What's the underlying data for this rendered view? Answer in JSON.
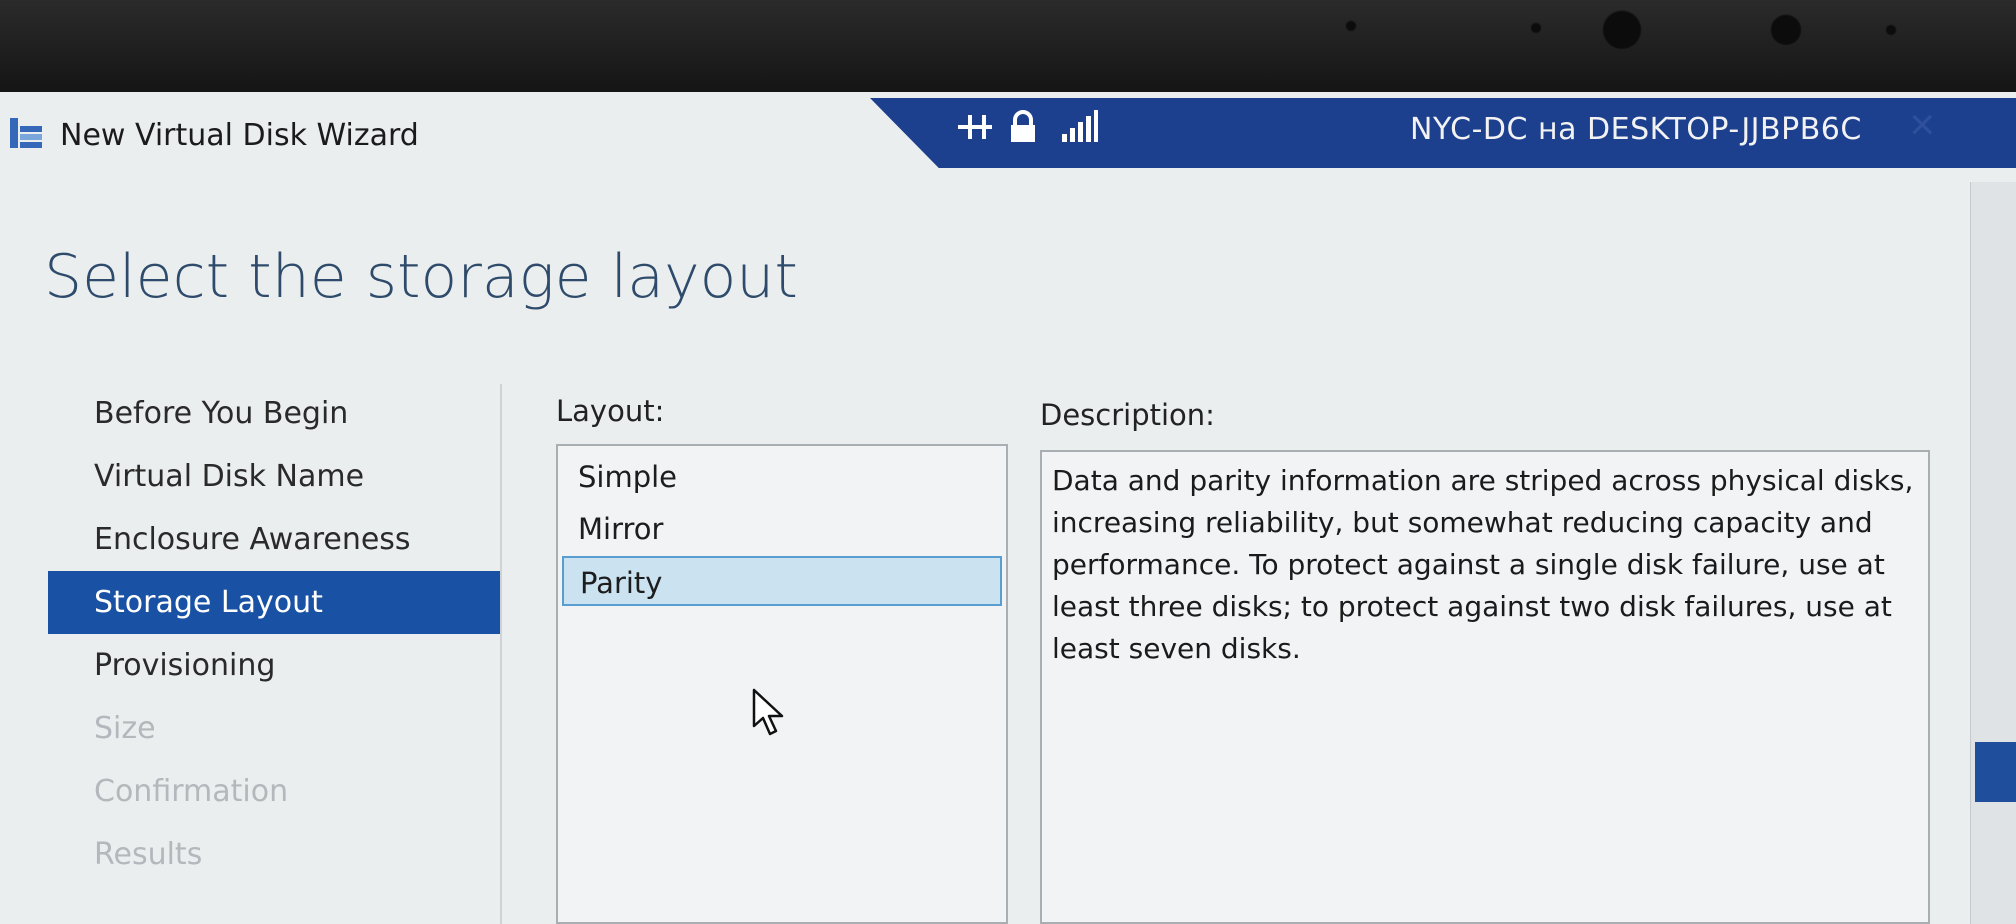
{
  "window": {
    "title": "New Virtual Disk Wizard"
  },
  "remote_session": {
    "title": "NYC-DC на DESKTOP-JJBPB6C",
    "icons": [
      "pin-icon",
      "lock-icon",
      "signal-icon"
    ],
    "close_glyph": "✕"
  },
  "page": {
    "heading": "Select the storage layout"
  },
  "nav": {
    "items": [
      {
        "label": "Before You Begin",
        "state": "normal"
      },
      {
        "label": "Virtual Disk Name",
        "state": "normal"
      },
      {
        "label": "Enclosure Awareness",
        "state": "normal"
      },
      {
        "label": "Storage Layout",
        "state": "active"
      },
      {
        "label": "Provisioning",
        "state": "normal"
      },
      {
        "label": "Size",
        "state": "disabled"
      },
      {
        "label": "Confirmation",
        "state": "disabled"
      },
      {
        "label": "Results",
        "state": "disabled"
      }
    ]
  },
  "layout": {
    "label": "Layout:",
    "options": [
      "Simple",
      "Mirror",
      "Parity"
    ],
    "selected": "Parity"
  },
  "description": {
    "label": "Description:",
    "text": "Data and parity information are striped across physical disks, increasing reliability, but somewhat reducing capacity and performance. To protect against a single disk failure, use at least three disks; to protect against two disk failures, use at least seven disks."
  },
  "colors": {
    "accent": "#1952a4",
    "rdp_bar": "#1c3f8e",
    "heading": "#2e4b6b",
    "selection_fill": "#cbe3f1",
    "disabled_text": "#b3b8bc"
  }
}
